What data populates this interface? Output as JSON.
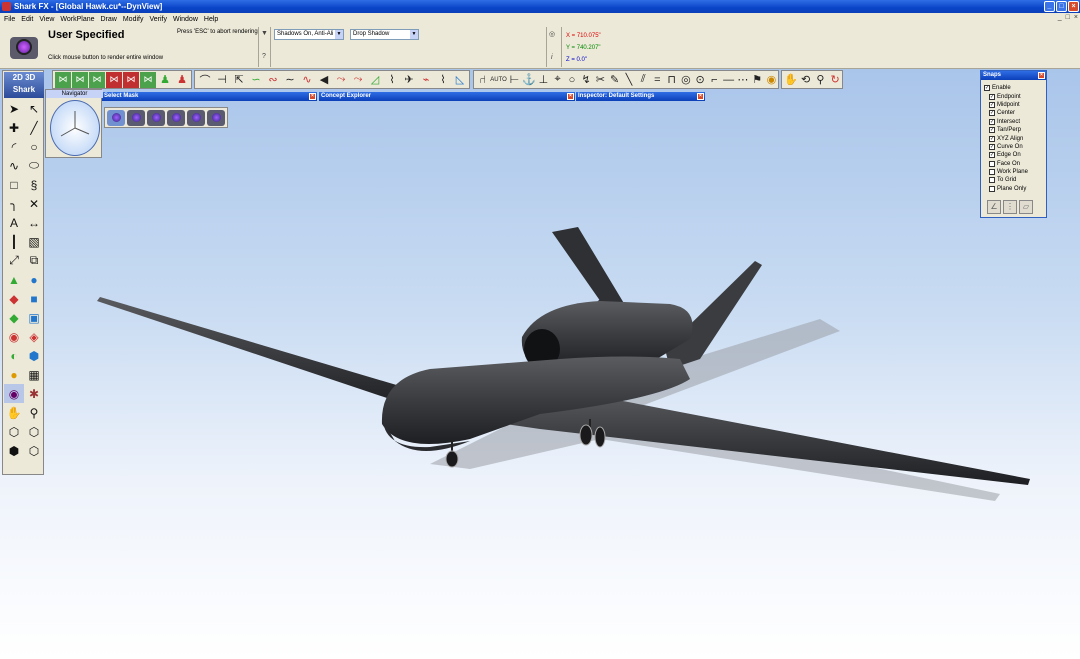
{
  "window": {
    "title": "Shark FX - [Global Hawk.cu*--DynView]",
    "controls": [
      "_",
      "□",
      "×"
    ]
  },
  "menu": {
    "items": [
      "File",
      "Edit",
      "View",
      "WorkPlane",
      "Draw",
      "Modify",
      "Verify",
      "Window",
      "Help"
    ],
    "mdi_controls": [
      "_",
      "□",
      "×"
    ]
  },
  "status": {
    "mode_title": "User Specified",
    "abort_message": "Press 'ESC' to abort rendering",
    "hint": "Click mouse button to render entire window",
    "help_mark": "?",
    "info_mark": "i",
    "shadows_select": "Shadows On, Anti-Ali",
    "shadow_type_select": "Drop Shadow",
    "coords": {
      "x": "X = 710.075\"",
      "y": "Y = 740.207\"",
      "z": "Z = 0.0\""
    }
  },
  "toolbox": {
    "logo_line1": "2D 3D",
    "logo_line2": "Shark"
  },
  "panels": {
    "navigator": "Navigator",
    "select_mask": "Select Mask",
    "concept_explorer": "Concept Explorer",
    "inspector": "Inspector: Default Settings",
    "close": "×"
  },
  "toolbar_misc": {
    "auto_label": "AUTO"
  },
  "snaps": {
    "title": "Snaps",
    "items": [
      {
        "label": "Enable",
        "checked": true,
        "indent": false
      },
      {
        "label": "Endpoint",
        "checked": true,
        "indent": true
      },
      {
        "label": "Midpoint",
        "checked": true,
        "indent": true
      },
      {
        "label": "Center",
        "checked": true,
        "indent": true
      },
      {
        "label": "Intersect",
        "checked": true,
        "indent": true
      },
      {
        "label": "Tan/Perp",
        "checked": true,
        "indent": true
      },
      {
        "label": "XYZ Align",
        "checked": true,
        "indent": true
      },
      {
        "label": "Curve On",
        "checked": true,
        "indent": true
      },
      {
        "label": "Edge On",
        "checked": true,
        "indent": true
      },
      {
        "label": "Face On",
        "checked": false,
        "indent": true
      },
      {
        "label": "Work Plane",
        "checked": false,
        "indent": true
      },
      {
        "label": "To Grid",
        "checked": false,
        "indent": true
      },
      {
        "label": "Plane Only",
        "checked": false,
        "indent": true
      }
    ]
  }
}
